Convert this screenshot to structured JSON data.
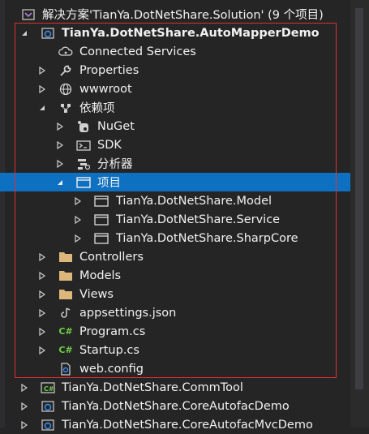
{
  "solution": {
    "label": "解决方案'TianYa.DotNetShare.Solution' (9 个项目)"
  },
  "project": {
    "label": "TianYa.DotNetShare.AutoMapperDemo"
  },
  "items": {
    "connected_services": "Connected Services",
    "properties": "Properties",
    "wwwroot": "wwwroot",
    "dependencies": "依赖项",
    "nuget": "NuGet",
    "sdk": "SDK",
    "analyzers": "分析器",
    "projects": "项目",
    "ref_model": "TianYa.DotNetShare.Model",
    "ref_service": "TianYa.DotNetShare.Service",
    "ref_sharpcore": "TianYa.DotNetShare.SharpCore",
    "controllers": "Controllers",
    "models": "Models",
    "views": "Views",
    "appsettings": "appsettings.json",
    "program": "Program.cs",
    "startup": "Startup.cs",
    "webconfig": "web.config"
  },
  "other_projects": [
    "TianYa.DotNetShare.CommTool",
    "TianYa.DotNetShare.CoreAutofacDemo",
    "TianYa.DotNetShare.CoreAutofacMvcDemo"
  ],
  "icons": {
    "csharp_glyph": "C#"
  },
  "colors": {
    "background": "#252526",
    "selection": "#0e70c0",
    "highlight_border": "#e03030",
    "folder": "#dcb67a",
    "csharp": "#6fcf46"
  }
}
